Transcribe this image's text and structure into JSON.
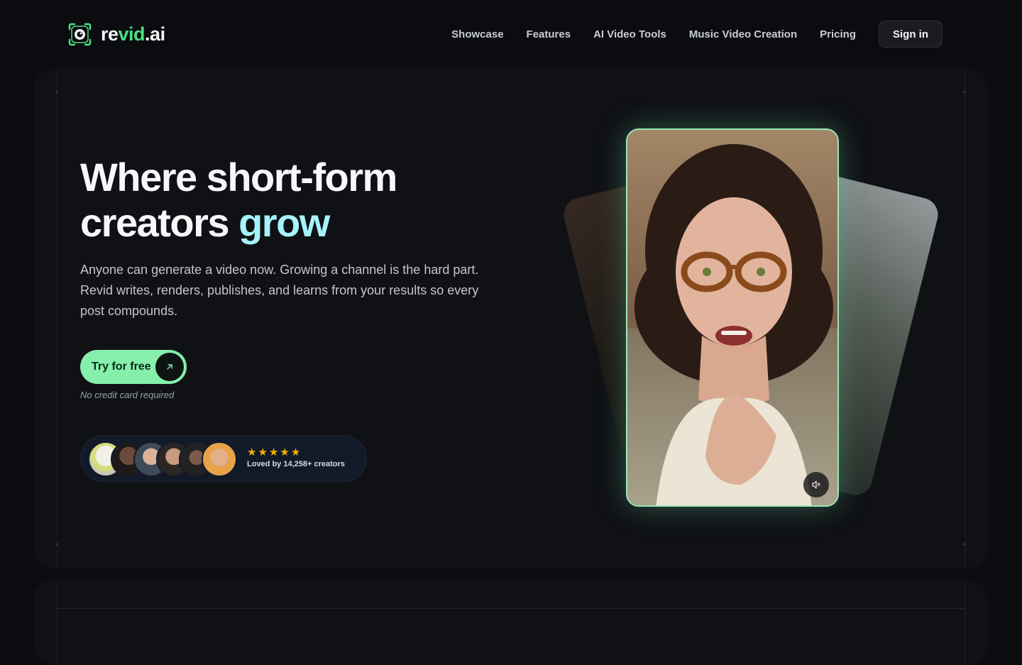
{
  "brand": {
    "name_prefix": "re",
    "name_accent": "vid",
    "name_suffix": ".ai",
    "logo_icon": "camera-eye-icon",
    "accent_color": "#4ade80"
  },
  "nav": {
    "links": [
      "Showcase",
      "Features",
      "AI Video Tools",
      "Music Video Creation",
      "Pricing"
    ],
    "signin_label": "Sign in"
  },
  "hero": {
    "title_line1": "Where short-form",
    "title_line2_prefix": "creators ",
    "title_line2_accent": "grow",
    "subtitle": "Anyone can generate a video now. Growing a channel is the hard part. Revid writes, renders, publishes, and learns from your results so every post compounds.",
    "cta_label": "Try for free",
    "cta_icon": "arrow-up-right-icon",
    "cta_note": "No credit card required",
    "accent_color": "#a5f3fc",
    "cta_color": "#86efac"
  },
  "social_proof": {
    "rating_stars": 5,
    "label": "Loved by 14,258+ creators",
    "avatar_count": 6
  },
  "video": {
    "mute_icon": "muted-speaker-icon"
  }
}
